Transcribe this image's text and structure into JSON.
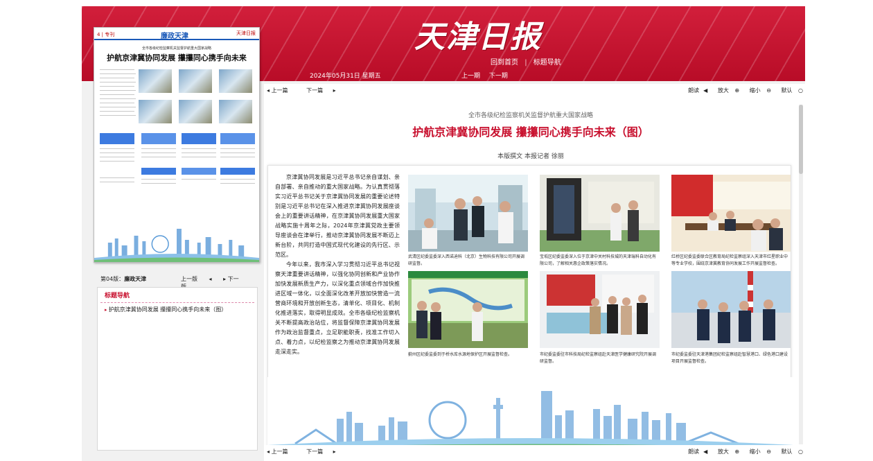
{
  "masthead": "天津日报",
  "topnav": {
    "home": "回到首页",
    "sep": "|",
    "guide": "标题导航"
  },
  "subbar": {
    "date": "2024年05月31日  星期五",
    "prev": "上一期",
    "next": "下一期"
  },
  "thumbnail": {
    "page": "4 | 专刊",
    "section": "廉政天津",
    "logo": "天津日报",
    "kicker": "全市各级纪检监察机关监督护航重大国家战略",
    "title": "护航京津冀协同发展  攥攥同心携手向未来"
  },
  "pagebar": {
    "current_label": "第04版：",
    "current_name": "廉政天津",
    "prev": "上一版",
    "next": "下一版"
  },
  "title_nav": {
    "header": "标题导航",
    "items": [
      "护航京津冀协同发展 攥攥同心携手向未来（图）"
    ]
  },
  "toolbar": {
    "prev_article": "上一篇",
    "next_article": "下一篇",
    "read": "朗读",
    "zoom_in": "放大",
    "zoom_out": "缩小",
    "default": "默认"
  },
  "article": {
    "kicker": "全市各级纪检监察机关监督护航重大国家战略",
    "headline": "护航京津冀协同发展  攥攥同心携手向未来（图）",
    "byline": "本版撰文  本报记者  徐丽",
    "paragraphs": [
      "京津冀协同发展是习近平总书记亲自谋划、亲自部署、亲自推动的重大国家战略。为认真贯彻落实习近平总书记关于京津冀协同发展的重要论述特别是习近平总书记在深入推进京津冀协同发展座谈会上的重要讲话精神，在京津冀协同发展重大国家战略实施十周年之际，2024年京津冀党政主要领导座谈会在津举行，推动京津冀协同发展不断迈上新台阶，共同打造中国式现代化建设的先行区、示范区。",
      "今年以来，我市深入学习贯彻习近平总书记视察天津重要讲话精神，以强化协同创新和产业协作加快发展新质生产力，以深化重点领域合作加快推进区域一体化，以全面深化改革开放加快营造一流营商环境和开放创新生态，清单化、项目化、机制化推进落实，取得明显成效。全市各级纪检监察机关不断提高政治站位，将监督保障京津冀协同发展作为政治监督重点，立足职能职责，找准工作切入点、着力点，以纪检监察之为推动京津冀协同发展走深走实。"
    ],
    "captions": [
      "武清区纪委监委深入西诺迪科（北京）生物科技有限公司开展调研监督。",
      "宝坻区纪委监委深入位于京津中关村科技城的天津瑞科自动化有限公司，了解相关惠企政策落实情况。",
      "红桥区纪委监委联合区教育局纪检监察组深入天津市红星职业中等专业学校，围绕京津冀教育协同发展工作开展监督检查。",
      "蓟州区纪委监委到于桥水库水源地保护区开展监督检查。",
      "市纪委监委驻市科技局纪检监察组赴天津医学健康研究院开展调研监督。",
      "市纪委监委驻天津港集团纪检监察组赴智慧港口、绿色港口建设项目开展监督检查。"
    ]
  },
  "colors": {
    "brand_red": "#c8102e",
    "link_blue": "#1a59b8"
  }
}
